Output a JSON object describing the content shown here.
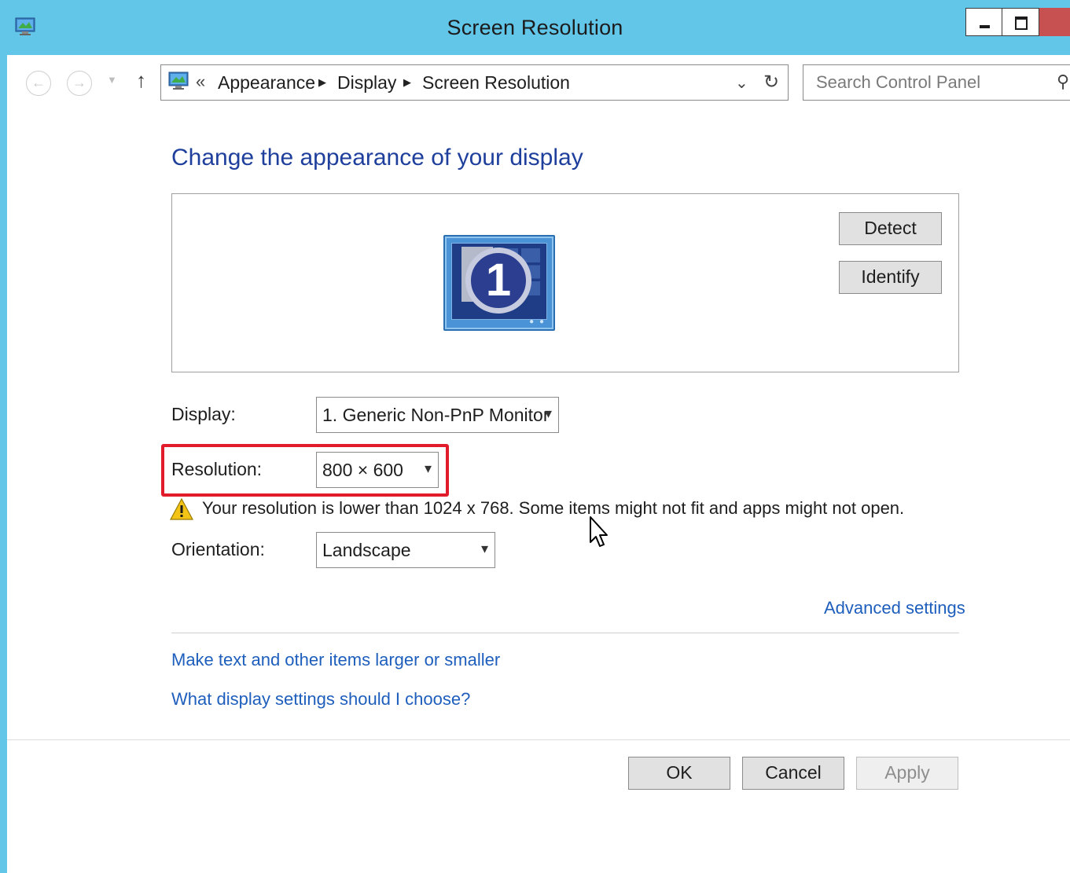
{
  "window": {
    "title": "Screen Resolution",
    "icon": "display-control-panel-icon"
  },
  "nav": {
    "back_icon": "back-arrow-icon",
    "forward_icon": "forward-arrow-icon",
    "up_icon": "up-arrow-icon",
    "overflow_chevron": "«",
    "breadcrumbs": [
      "Appearance",
      "Display",
      "Screen Resolution"
    ],
    "search_placeholder": "Search Control Panel"
  },
  "main": {
    "heading": "Change the appearance of your display",
    "monitor_number": "1",
    "detect_label": "Detect",
    "identify_label": "Identify",
    "display_label": "Display:",
    "display_value": "1. Generic Non-PnP Monitor",
    "resolution_label": "Resolution:",
    "resolution_value": "800 × 600",
    "warning_text": "Your resolution is lower than 1024 x 768. Some items might not fit and apps might not open.",
    "orientation_label": "Orientation:",
    "orientation_value": "Landscape",
    "advanced_link": "Advanced settings",
    "links": [
      "Make text and other items larger or smaller",
      "What display settings should I choose?"
    ]
  },
  "footer": {
    "ok_label": "OK",
    "cancel_label": "Cancel",
    "apply_label": "Apply"
  },
  "colors": {
    "titlebar": "#62c6e9",
    "link": "#1e5ebc",
    "heading": "#1e3f9c",
    "highlight": "#e21b2a",
    "close_button": "#c75050"
  }
}
